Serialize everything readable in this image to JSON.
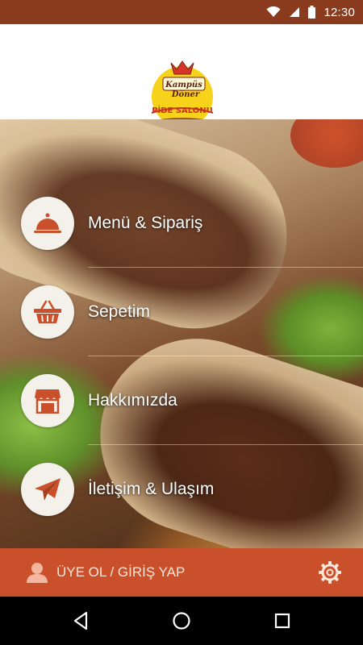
{
  "status_bar": {
    "time": "12:30",
    "icons": [
      "wifi-icon",
      "cell-signal-icon",
      "battery-icon"
    ]
  },
  "logo": {
    "line1": "Kampüs",
    "line2": "Döner",
    "line3": "PİDE SALONU"
  },
  "menu": {
    "items": [
      {
        "label": "Menü & Sipariş",
        "icon": "cloche-icon"
      },
      {
        "label": "Sepetim",
        "icon": "basket-icon"
      },
      {
        "label": "Hakkımızda",
        "icon": "storefront-icon"
      },
      {
        "label": "İletişim & Ulaşım",
        "icon": "paper-plane-icon"
      }
    ]
  },
  "bottom_bar": {
    "login_label": "ÜYE OL / GİRİŞ YAP",
    "user_icon": "user-icon",
    "settings_icon": "gear-icon"
  },
  "nav_bar": {
    "buttons": [
      "back-icon",
      "home-icon",
      "recents-icon"
    ]
  },
  "colors": {
    "status_bar": "#8a3b1e",
    "accent": "#c9502a",
    "icon_tint": "#c9502a"
  }
}
